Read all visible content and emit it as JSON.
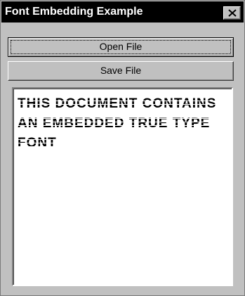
{
  "window": {
    "title": "Font Embedding Example"
  },
  "titlebar": {
    "close_icon": "close-icon"
  },
  "buttons": {
    "open_label": "Open File",
    "save_label": "Save File"
  },
  "document": {
    "text": "THIS DOCUMENT CONTAINS AN EMBEDDED TRUE TYPE FONT"
  },
  "colors": {
    "face": "#c0c0c0",
    "titlebar": "#000000",
    "title_text": "#ffffff",
    "document_bg": "#ffffff"
  }
}
